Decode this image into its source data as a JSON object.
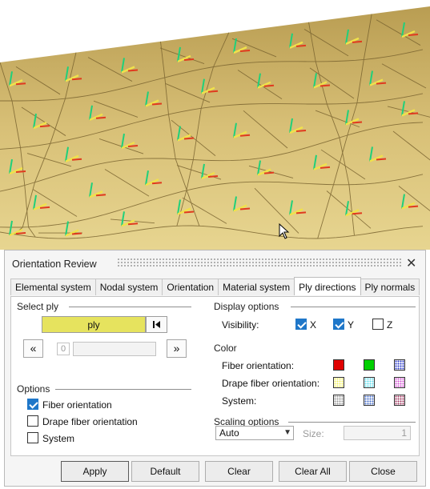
{
  "dialog": {
    "title": "Orientation Review",
    "close_glyph": "✕",
    "tabs": [
      {
        "label": "Elemental system",
        "active": false
      },
      {
        "label": "Nodal system",
        "active": false
      },
      {
        "label": "Orientation",
        "active": false
      },
      {
        "label": "Material system",
        "active": false
      },
      {
        "label": "Ply directions",
        "active": true
      },
      {
        "label": "Ply normals",
        "active": false
      }
    ],
    "select_ply": {
      "group_label": "Select ply",
      "ply_button_label": "ply",
      "first_glyph": "⏮",
      "prev_label": "«",
      "next_label": "»",
      "index_value": "0",
      "ply_name_value": ""
    },
    "options": {
      "group_label": "Options",
      "items": [
        {
          "label": "Fiber orientation",
          "checked": true
        },
        {
          "label": "Drape fiber orientation",
          "checked": false
        },
        {
          "label": "System",
          "checked": false
        }
      ]
    },
    "display_options": {
      "group_label": "Display options",
      "visibility_label": "Visibility:",
      "axes": [
        {
          "label": "X",
          "checked": true
        },
        {
          "label": "Y",
          "checked": true
        },
        {
          "label": "Z",
          "checked": false
        }
      ]
    },
    "color": {
      "group_label": "Color",
      "rows": [
        {
          "label": "Fiber orientation:",
          "colors": [
            "#e00000",
            "#00d000",
            "#2c3cc8"
          ]
        },
        {
          "label": "Drape fiber orientation:",
          "colors": [
            "#f3f160",
            "#60dcec",
            "#d050d0"
          ]
        },
        {
          "label": "System:",
          "colors": [
            "#9a9a9a",
            "#4a70c8",
            "#a03860"
          ]
        }
      ]
    },
    "scaling": {
      "group_label": "Scaling options",
      "mode_value": "Auto",
      "size_label": "Size:",
      "size_value": "1"
    },
    "buttons": {
      "apply": "Apply",
      "default": "Default",
      "clear": "Clear",
      "clear_all": "Clear All",
      "close": "Close"
    }
  }
}
